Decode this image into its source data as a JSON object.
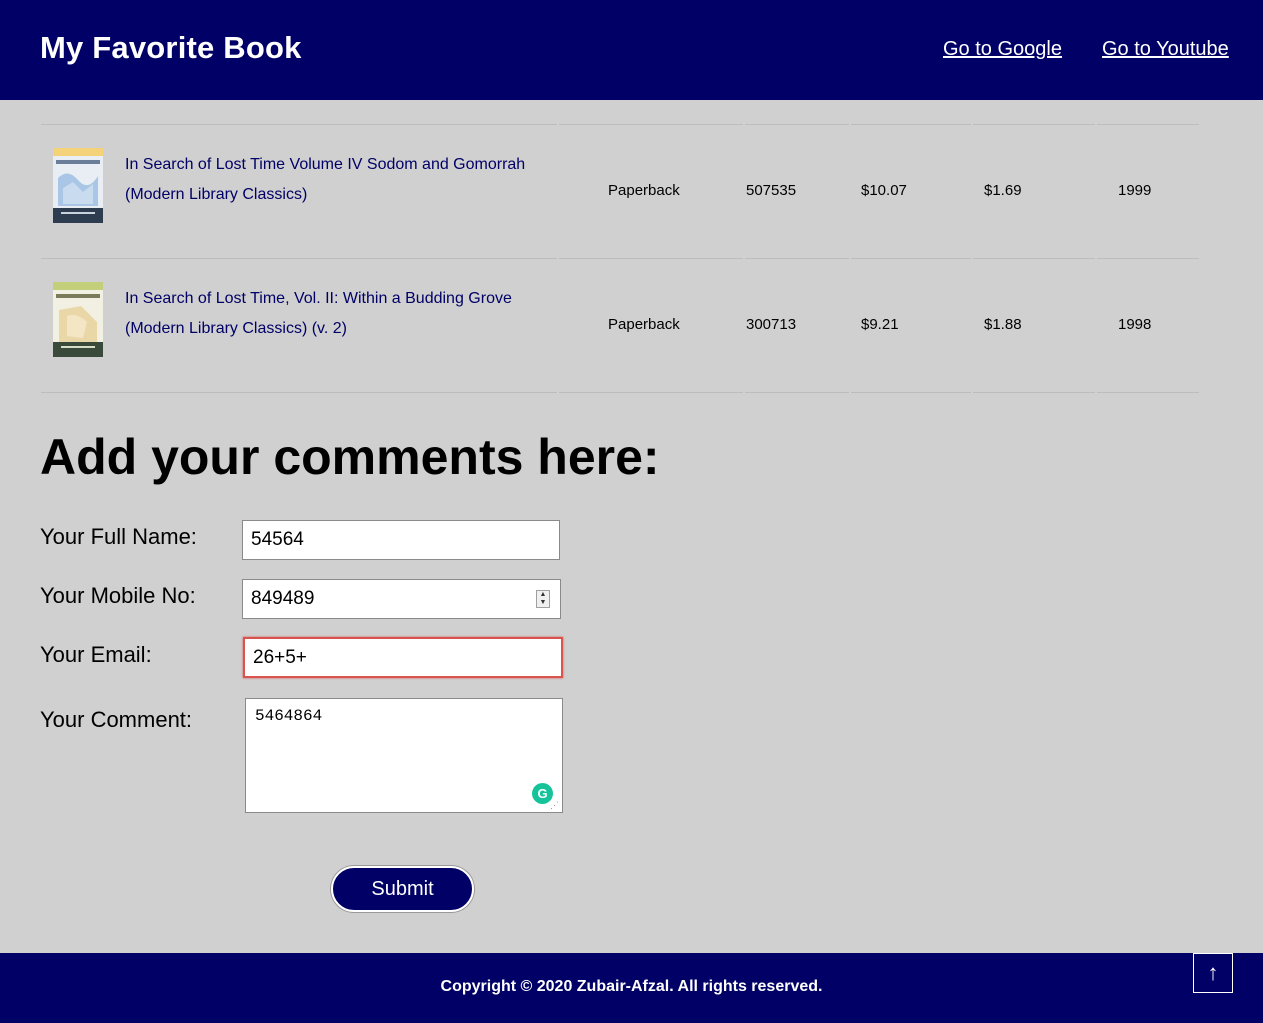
{
  "header": {
    "title": "My Favorite Book",
    "nav": [
      {
        "label": "Go to Google"
      },
      {
        "label": "Go to Youtube"
      }
    ],
    "bg_color": "#000066"
  },
  "books": [
    {
      "title_line1": "In Search of Lost Time Volume IV Sodom and Gomorrah",
      "title_line2": "(Modern Library Classics)",
      "format": "Paperback",
      "rank": "507535",
      "price": "$10.07",
      "shipping": "$1.69",
      "year": "1999"
    },
    {
      "title_line1": "In Search of Lost Time, Vol. II: Within a Budding Grove",
      "title_line2": "(Modern Library Classics) (v. 2)",
      "format": "Paperback",
      "rank": "300713",
      "price": "$9.21",
      "shipping": "$1.88",
      "year": "1998"
    }
  ],
  "comments": {
    "heading": "Add your comments here:",
    "fields": {
      "name": {
        "label": "Your Full Name:",
        "value": "54564"
      },
      "mobile": {
        "label": "Your Mobile No:",
        "value": "849489"
      },
      "email": {
        "label": "Your Email:",
        "value": "26+5+"
      },
      "comment": {
        "label": "Your Comment:",
        "value": "5464864"
      }
    },
    "submit_label": "Submit"
  },
  "footer": {
    "copyright": "Copyright © 2020 Zubair-Afzal. All rights reserved.",
    "back_to_top_icon": "↑"
  },
  "colors": {
    "brand": "#000066",
    "page_bg": "#d0d0d0",
    "error": "#d9534f"
  }
}
